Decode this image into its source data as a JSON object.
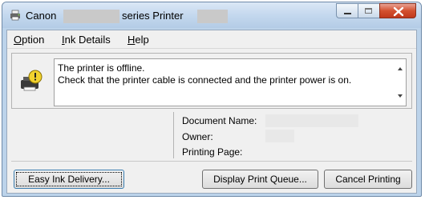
{
  "window": {
    "title_prefix": "Canon",
    "title_middle": "series Printer"
  },
  "menu": {
    "option": {
      "accel": "O",
      "rest": "ption"
    },
    "ink": {
      "accel": "I",
      "rest": "nk Details"
    },
    "help": {
      "accel": "H",
      "rest": "elp"
    }
  },
  "status": {
    "message": "The printer is offline.\nCheck that the printer cable is connected and the printer power is on."
  },
  "job": {
    "document_label": "Document Name:",
    "owner_label": "Owner:",
    "page_label": "Printing Page:"
  },
  "buttons": {
    "easy_ink": "Easy Ink Delivery...",
    "queue": "Display Print Queue...",
    "cancel": "Cancel Printing"
  },
  "colors": {
    "title_bar": "#c4d8ee",
    "close_button": "#d3502f",
    "warning_yellow": "#f2d22e"
  }
}
